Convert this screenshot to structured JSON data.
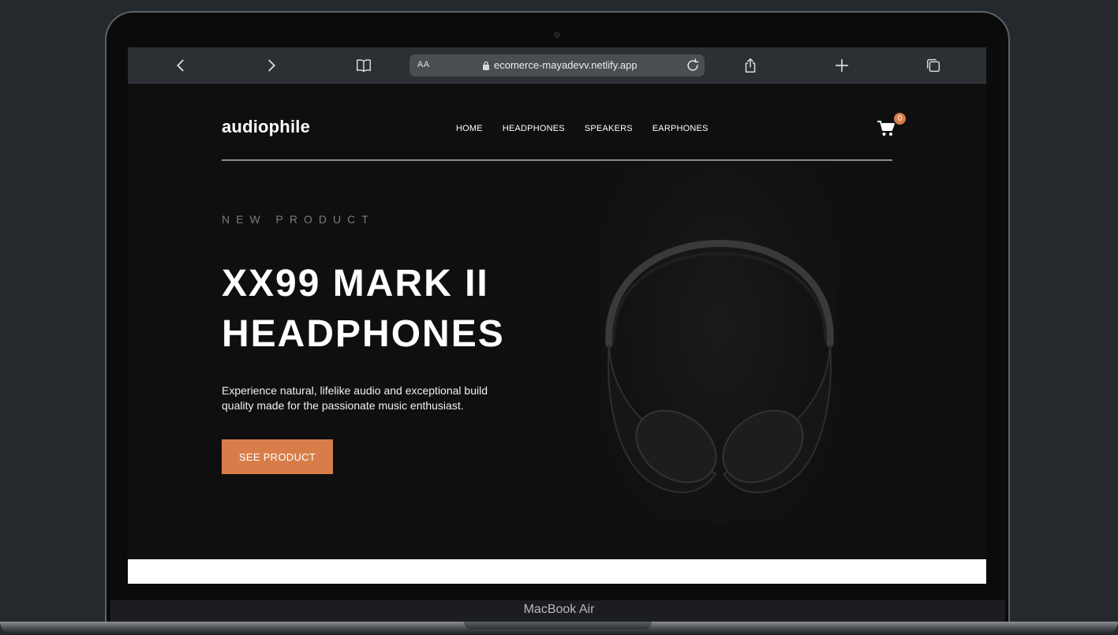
{
  "device": {
    "label": "MacBook Air"
  },
  "browser": {
    "text_size_label": "AA",
    "url": "ecomerce-mayadevv.netlify.app",
    "icons": [
      "back-icon",
      "forward-icon",
      "bookmarks-icon",
      "lock-icon",
      "reload-icon",
      "share-icon",
      "new-tab-icon",
      "tabs-icon"
    ]
  },
  "site": {
    "logo": "audiophile",
    "nav": [
      "HOME",
      "HEADPHONES",
      "SPEAKERS",
      "EARPHONES"
    ],
    "cart_count": "0",
    "accent": "#d87d4a"
  },
  "hero": {
    "eyebrow": "NEW PRODUCT",
    "title_line1": "XX99 MARK II",
    "title_line2": "HEADPHONES",
    "description": "Experience natural, lifelike audio and exceptional build quality made for the passionate music enthusiast.",
    "cta": "SEE PRODUCT"
  }
}
